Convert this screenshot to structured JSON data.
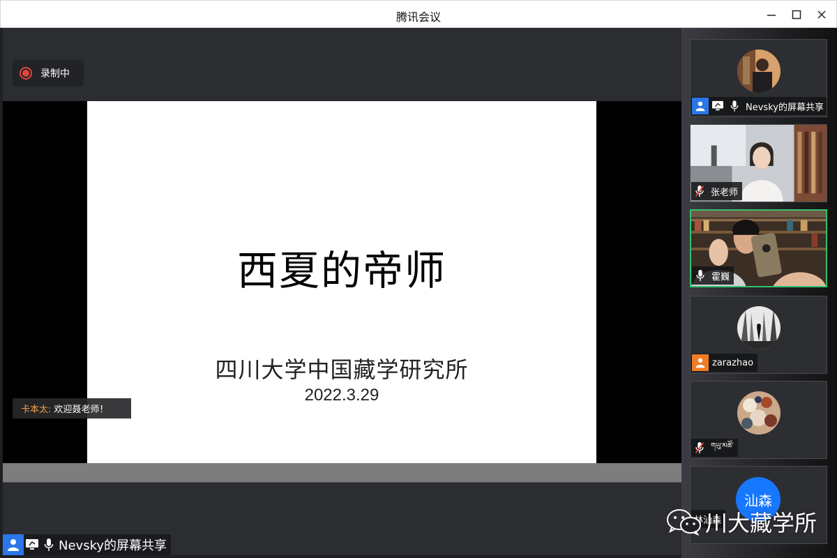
{
  "window": {
    "title": "腾讯会议"
  },
  "recording": {
    "label": "录制中"
  },
  "slide": {
    "title": "西夏的帝师",
    "subtitle": "四川大学中国藏学研究所",
    "date": "2022.3.29"
  },
  "chat": {
    "sender": "卡本太:",
    "message": "欢迎聂老师！"
  },
  "bottom_share": {
    "label": "Nevsky的屏幕共享"
  },
  "participants": [
    {
      "name": "Nevsky的屏幕共享",
      "icon": "user-icon"
    },
    {
      "name": "张老师",
      "icon": "mic-muted-icon"
    },
    {
      "name": "霍巍",
      "icon": "mic-icon"
    },
    {
      "name": "zarazhao",
      "icon": "user-orange-icon"
    },
    {
      "name": "གཡུ་མཚོ་",
      "icon": "mic-muted-icon"
    },
    {
      "name": "林汕森",
      "avatar_text": "汕森"
    }
  ],
  "watermark": {
    "text": "川大藏学所",
    "icon": "wechat-icon"
  },
  "colors": {
    "accent": "#2b76e8",
    "record": "#e5463b",
    "active_border": "#33c36c",
    "chat_name": "#f5a04a",
    "avatar_blue": "#1677ff"
  }
}
